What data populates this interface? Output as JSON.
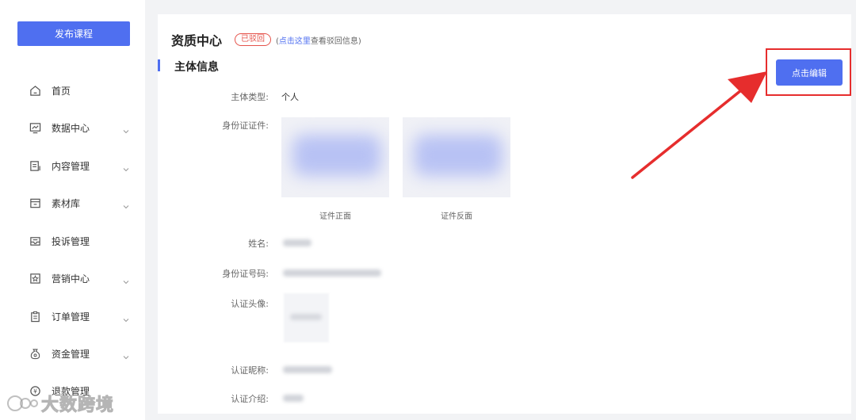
{
  "sidebar": {
    "publish_label": "发布课程",
    "items": [
      {
        "label": "首页",
        "icon": "home-icon",
        "has_caret": false
      },
      {
        "label": "数据中心",
        "icon": "chart-icon",
        "has_caret": true
      },
      {
        "label": "内容管理",
        "icon": "document-icon",
        "has_caret": true
      },
      {
        "label": "素材库",
        "icon": "folder-icon",
        "has_caret": true
      },
      {
        "label": "投诉管理",
        "icon": "inbox-icon",
        "has_caret": false
      },
      {
        "label": "营销中心",
        "icon": "star-icon",
        "has_caret": true
      },
      {
        "label": "订单管理",
        "icon": "clipboard-icon",
        "has_caret": true
      },
      {
        "label": "资金管理",
        "icon": "money-bag-icon",
        "has_caret": true
      },
      {
        "label": "退款管理",
        "icon": "refund-icon",
        "has_caret": false
      }
    ]
  },
  "header": {
    "title": "资质中心",
    "status": "已驳回",
    "hint_prefix": "(",
    "hint_link": "点击这里",
    "hint_suffix": "查看驳回信息)"
  },
  "section": {
    "title": "主体信息",
    "edit_label": "点击编辑"
  },
  "fields": {
    "subject_type_label": "主体类型:",
    "subject_type_value": "个人",
    "id_docs_label": "身份证证件:",
    "id_front_caption": "证件正面",
    "id_back_caption": "证件反面",
    "name_label": "姓名:",
    "id_number_label": "身份证号码:",
    "avatar_label": "认证头像:",
    "nickname_label": "认证昵称:",
    "intro_label": "认证介绍:"
  },
  "watermark": "大数跨境",
  "colors": {
    "accent": "#4f6ff0",
    "reject": "#e5534b",
    "annotation": "#e62d2d"
  }
}
